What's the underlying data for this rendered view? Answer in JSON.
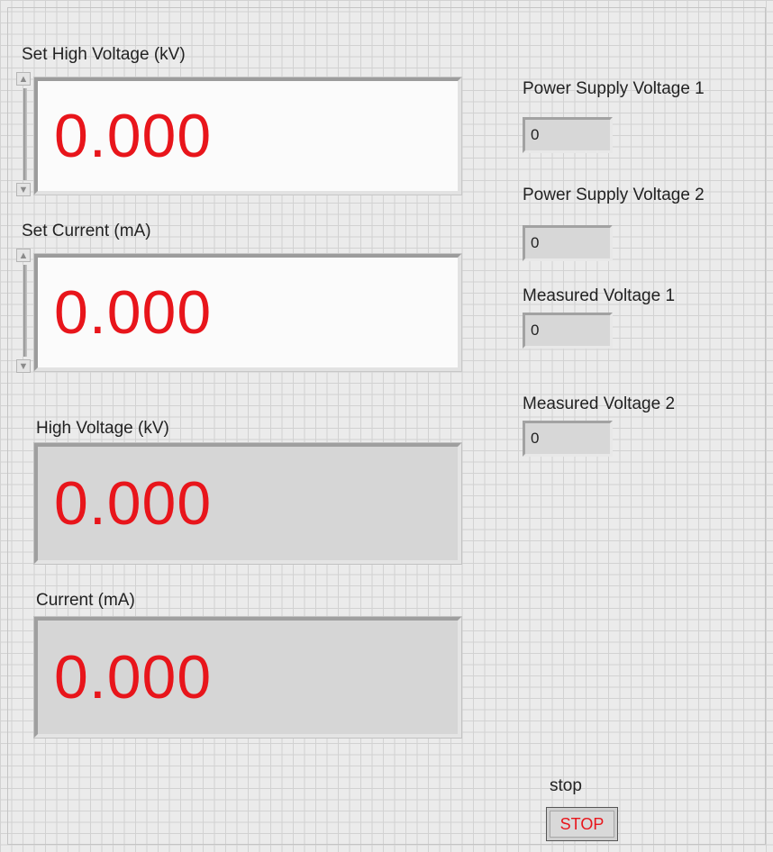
{
  "controls": {
    "set_high_voltage": {
      "label": "Set High Voltage (kV)",
      "value": "0.000"
    },
    "set_current": {
      "label": "Set Current (mA)",
      "value": "0.000"
    }
  },
  "indicators": {
    "high_voltage": {
      "label": "High Voltage (kV)",
      "value": "0.000"
    },
    "current": {
      "label": "Current (mA)",
      "value": "0.000"
    }
  },
  "side_indicators": [
    {
      "label": "Power Supply Voltage 1",
      "value": "0"
    },
    {
      "label": "Power Supply Voltage 2",
      "value": "0"
    },
    {
      "label": "Measured Voltage 1",
      "value": "0"
    },
    {
      "label": "Measured Voltage 2",
      "value": "0"
    }
  ],
  "stop": {
    "label": "stop",
    "button_text": "STOP"
  },
  "icons": {
    "increment": "triangle-up-icon",
    "decrement": "triangle-down-icon"
  },
  "colors": {
    "value_red": "#e8151b",
    "background": "#ebebeb",
    "grid": "#d2d2d2"
  }
}
